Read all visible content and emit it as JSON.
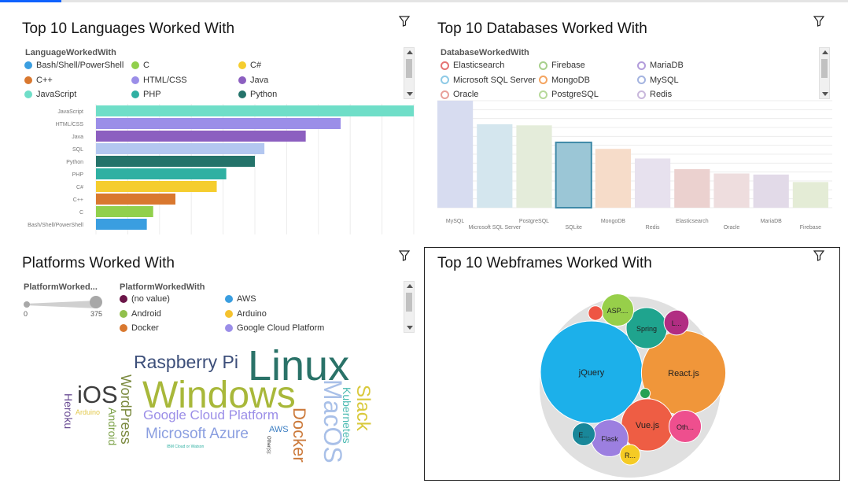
{
  "tiles": {
    "languages": {
      "title": "Top 10 Languages Worked With",
      "legend_title": "LanguageWorkedWith"
    },
    "databases": {
      "title": "Top 10 Databases Worked With",
      "legend_title": "DatabaseWorkedWith"
    },
    "platforms": {
      "title": "Platforms Worked With",
      "slider_title": "PlatformWorked...",
      "slider_min": "0",
      "slider_max": "375",
      "slider_level": 1.0,
      "legend_title": "PlatformWorkedWith"
    },
    "webframes": {
      "title": "Top 10 Webframes Worked With"
    }
  },
  "icons": {
    "filter": "filter-icon"
  },
  "chart_data": [
    {
      "type": "bar",
      "orientation": "horizontal",
      "title": "Top 10 Languages Worked With",
      "categories": [
        "JavaScript",
        "HTML/CSS",
        "Java",
        "SQL",
        "Python",
        "PHP",
        "C#",
        "C++",
        "C",
        "Bash/Shell/PowerShell"
      ],
      "values": [
        100,
        77,
        66,
        53,
        50,
        41,
        38,
        25,
        18,
        16
      ],
      "colors": [
        "#6fdec8",
        "#9b8ee8",
        "#8c5fc0",
        "#b3c7f0",
        "#24736a",
        "#2fb0a2",
        "#f5cd2e",
        "#d9782f",
        "#91d04c",
        "#3a9ee0"
      ],
      "legend": [
        {
          "label": "Bash/Shell/PowerShell",
          "color": "#3a9ee0"
        },
        {
          "label": "C",
          "color": "#91d04c"
        },
        {
          "label": "C#",
          "color": "#f5cd2e"
        },
        {
          "label": "C++",
          "color": "#d9782f"
        },
        {
          "label": "HTML/CSS",
          "color": "#9b8ee8"
        },
        {
          "label": "Java",
          "color": "#8c5fc0"
        },
        {
          "label": "JavaScript",
          "color": "#6fdec8"
        },
        {
          "label": "PHP",
          "color": "#2fb0a2"
        },
        {
          "label": "Python",
          "color": "#24736a"
        }
      ],
      "grid": true
    },
    {
      "type": "bar",
      "orientation": "vertical",
      "title": "Top 10 Databases Worked With",
      "categories": [
        "MySQL",
        "Microsoft SQL Server",
        "PostgreSQL",
        "SQLite",
        "MongoDB",
        "Redis",
        "Elasticsearch",
        "Oracle",
        "MariaDB",
        "Firebase"
      ],
      "values": [
        100,
        78,
        77,
        61,
        55,
        46,
        36,
        32,
        31,
        24
      ],
      "colors": [
        "#d7dcf0",
        "#d4e6ee",
        "#e4ecda",
        "#9bc6d6",
        "#f6dcc9",
        "#e7e1ee",
        "#ebd1cf",
        "#eeddde",
        "#e2dae8",
        "#e4ecd6"
      ],
      "highlight": "SQLite",
      "legend": [
        {
          "label": "Elasticsearch",
          "color": "#e57373"
        },
        {
          "label": "Firebase",
          "color": "#a8d08d"
        },
        {
          "label": "MariaDB",
          "color": "#b39ddb"
        },
        {
          "label": "Microsoft SQL Server",
          "color": "#8ecae6"
        },
        {
          "label": "MongoDB",
          "color": "#f4a460"
        },
        {
          "label": "MySQL",
          "color": "#a4b4e0"
        },
        {
          "label": "Oracle",
          "color": "#e8a09a"
        },
        {
          "label": "PostgreSQL",
          "color": "#b7d99a"
        },
        {
          "label": "Redis",
          "color": "#c9b8dc"
        }
      ],
      "grid": true
    },
    {
      "type": "wordcloud",
      "title": "Platforms Worked With",
      "words": [
        {
          "text": "Linux",
          "weight": 100,
          "color": "#2a7268"
        },
        {
          "text": "Windows",
          "weight": 88,
          "color": "#a8b83a"
        },
        {
          "text": "Raspberry Pi",
          "weight": 46,
          "color": "#3d4f7a"
        },
        {
          "text": "MacOS",
          "weight": 55,
          "color": "#a9c0e8"
        },
        {
          "text": "iOS",
          "weight": 52,
          "color": "#3d3d3d"
        },
        {
          "text": "Docker",
          "weight": 42,
          "color": "#cc7a3b"
        },
        {
          "text": "Slack",
          "weight": 42,
          "color": "#d9c93c"
        },
        {
          "text": "WordPress",
          "weight": 35,
          "color": "#7b8a3f"
        },
        {
          "text": "Microsoft Azure",
          "weight": 38,
          "color": "#8a9ee0"
        },
        {
          "text": "Google Cloud Platform",
          "weight": 32,
          "color": "#9b8ee8"
        },
        {
          "text": "Kubernetes",
          "weight": 30,
          "color": "#4bbab1"
        },
        {
          "text": "Android",
          "weight": 28,
          "color": "#7ea34b"
        },
        {
          "text": "Heroku",
          "weight": 28,
          "color": "#6a4c93"
        },
        {
          "text": "Arduino",
          "weight": 14,
          "color": "#e2c84a"
        },
        {
          "text": "AWS",
          "weight": 14,
          "color": "#3a7dc2"
        },
        {
          "text": "IBM Cloud or Watson",
          "weight": 6,
          "color": "#2fb0a2"
        },
        {
          "text": "Other(s):",
          "weight": 6,
          "color": "#333333"
        }
      ],
      "legend": [
        {
          "label": "(no value)",
          "color": "#6b1548"
        },
        {
          "label": "AWS",
          "color": "#3a9ee0"
        },
        {
          "label": "Android",
          "color": "#91c04c"
        },
        {
          "label": "Arduino",
          "color": "#f5c22e"
        },
        {
          "label": "Docker",
          "color": "#d9782f"
        },
        {
          "label": "Google Cloud Platform",
          "color": "#9b8ee8"
        }
      ]
    },
    {
      "type": "bubble",
      "title": "Top 10 Webframes Worked With",
      "bubbles": [
        {
          "label": "jQuery",
          "value": 100,
          "color": "#1cb0ea"
        },
        {
          "label": "React.js",
          "value": 68,
          "color": "#f0963a"
        },
        {
          "label": "Vue.js",
          "value": 26,
          "color": "#ee5d44"
        },
        {
          "label": "Spring",
          "value": 16,
          "color": "#1fa48e"
        },
        {
          "label": "ASP....",
          "value": 10,
          "color": "#97cf4a"
        },
        {
          "label": "Oth...",
          "value": 10,
          "color": "#ee4f8e"
        },
        {
          "label": "Flask",
          "value": 13,
          "color": "#9c7fe0"
        },
        {
          "label": "L...",
          "value": 6,
          "color": "#b12d82"
        },
        {
          "label": "E...",
          "value": 5,
          "color": "#198799"
        },
        {
          "label": "R...",
          "value": 4,
          "color": "#f5cb25"
        },
        {
          "label": "",
          "value": 2,
          "color": "#ee5544"
        },
        {
          "label": "",
          "value": 1,
          "color": "#27a154"
        }
      ]
    }
  ]
}
